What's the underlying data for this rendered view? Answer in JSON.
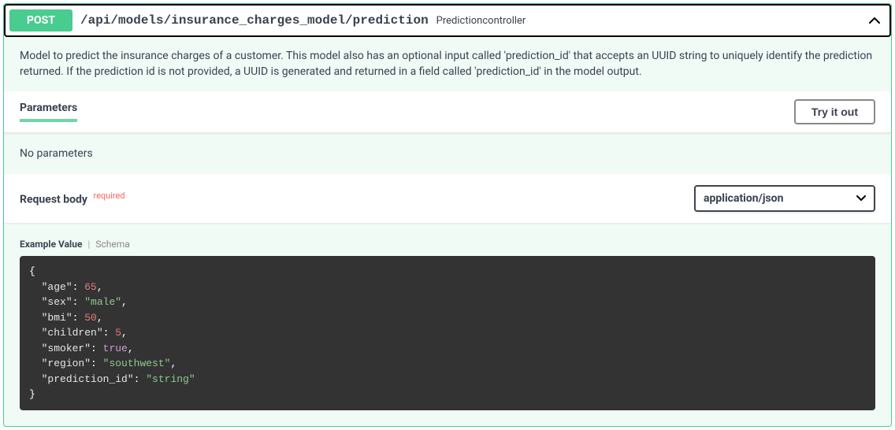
{
  "summary": {
    "method": "POST",
    "path": "/api/models/insurance_charges_model/prediction",
    "controller": "Predictioncontroller"
  },
  "description": "Model to predict the insurance charges of a customer. This model also has an optional input called 'prediction_id' that accepts an UUID string to uniquely identify the prediction returned. If the prediction id is not provided, a UUID is generated and returned in a field called 'prediction_id' in the model output.",
  "parameters": {
    "title": "Parameters",
    "try_label": "Try it out",
    "empty_text": "No parameters"
  },
  "request_body": {
    "title": "Request body",
    "required_label": "required",
    "content_type": "application/json"
  },
  "example": {
    "tab_example": "Example Value",
    "tab_schema": "Schema",
    "fields": [
      {
        "key": "age",
        "type": "number",
        "value": "65"
      },
      {
        "key": "sex",
        "type": "string",
        "value": "\"male\""
      },
      {
        "key": "bmi",
        "type": "number",
        "value": "50"
      },
      {
        "key": "children",
        "type": "number",
        "value": "5"
      },
      {
        "key": "smoker",
        "type": "boolean",
        "value": "true"
      },
      {
        "key": "region",
        "type": "string",
        "value": "\"southwest\""
      },
      {
        "key": "prediction_id",
        "type": "string",
        "value": "\"string\""
      }
    ]
  }
}
